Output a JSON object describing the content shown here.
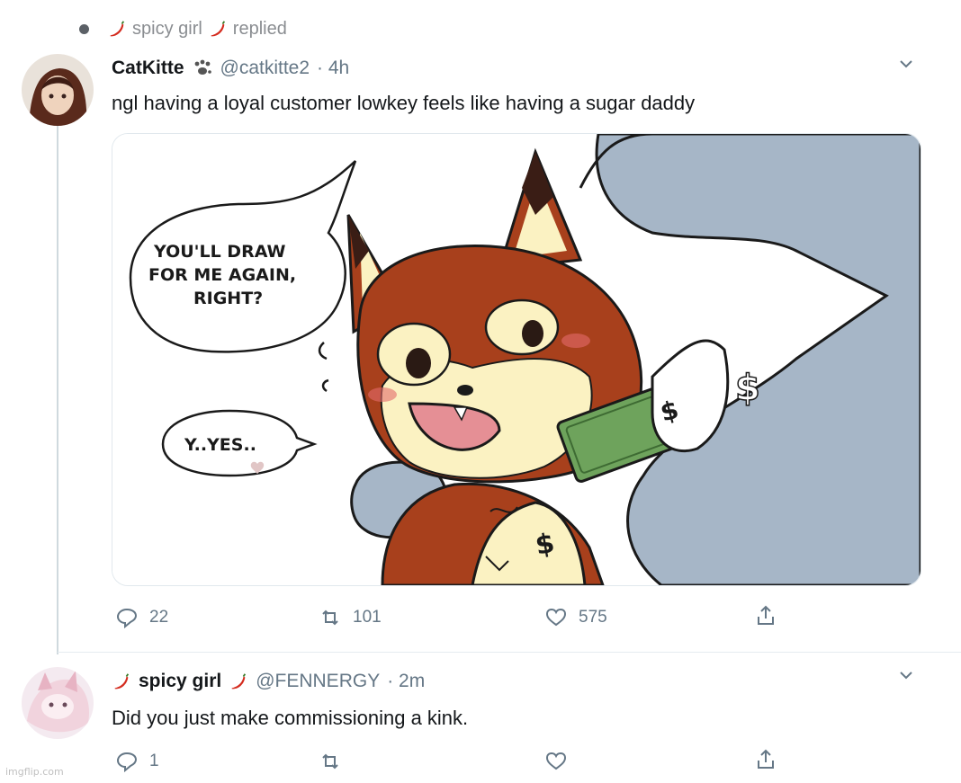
{
  "context": {
    "name": "spicy girl",
    "action": "replied"
  },
  "tweet1": {
    "name": "CatKitte",
    "handle": "@catkitte2",
    "time": "· 4h",
    "text": "ngl having a loyal customer lowkey feels like having a sugar daddy",
    "media": {
      "bubble_lines": [
        "YOU'LL DRAW",
        "FOR ME AGAIN,",
        "RIGHT?"
      ],
      "reply_bubble": "Y..YES..",
      "money_symbol": "$"
    },
    "replies": "22",
    "retweets": "101",
    "likes": "575"
  },
  "tweet2": {
    "name": "spicy girl",
    "handle": "@FENNERGY",
    "time": "· 2m",
    "text": "Did you just make commissioning a kink.",
    "replies": "1"
  },
  "watermark": "imgflip.com",
  "colors": {
    "chili": "#d42b1e",
    "fur": "#a8401c",
    "sky": "#a6b6c7",
    "cream": "#fbf2c2",
    "cash": "#6ea35c"
  },
  "icons": [
    "chili-icon",
    "paw-icon",
    "chevron-down-icon",
    "reply-icon",
    "retweet-icon",
    "like-icon",
    "share-icon"
  ]
}
